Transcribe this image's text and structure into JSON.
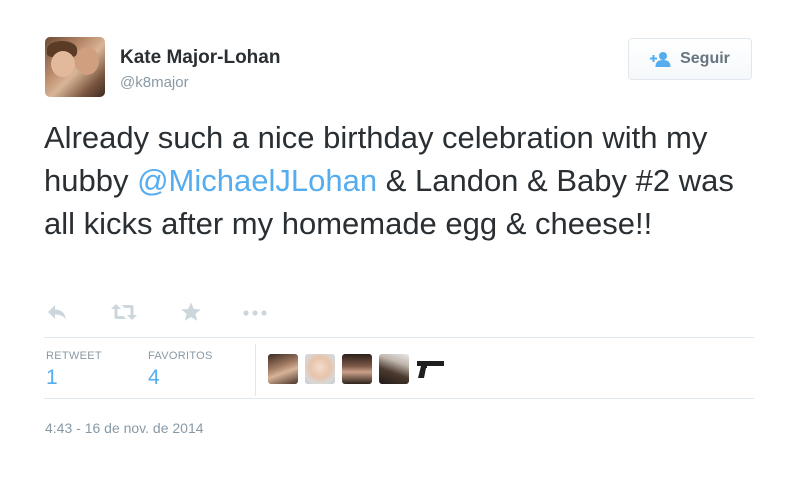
{
  "user": {
    "name": "Kate Major-Lohan",
    "handle": "@k8major"
  },
  "follow_button": {
    "label": "Seguir",
    "icon": "add-user-icon",
    "color": "#55acee"
  },
  "tweet": {
    "text_before": "Already such a nice birthday celebration with my hubby ",
    "mention": "@MichaelJLohan",
    "text_after": " & Landon & Baby #2 was all kicks after my homemade egg & cheese!!"
  },
  "actions": [
    {
      "name": "reply-icon"
    },
    {
      "name": "retweet-icon"
    },
    {
      "name": "favorite-star-icon"
    },
    {
      "name": "more-ellipsis-icon"
    }
  ],
  "stats": {
    "retweets_label": "RETWEET",
    "retweets_count": "1",
    "favorites_label": "FAVORITOS",
    "favorites_count": "4"
  },
  "favorited_by": [
    "avatar-1",
    "avatar-2",
    "avatar-3",
    "avatar-4",
    "avatar-5-gun-icon"
  ],
  "timestamp": "4:43 - 16 de nov. de 2014",
  "colors": {
    "link": "#55acee",
    "muted": "#8899a6",
    "text": "#292f33",
    "divider": "#e1e8ed"
  }
}
